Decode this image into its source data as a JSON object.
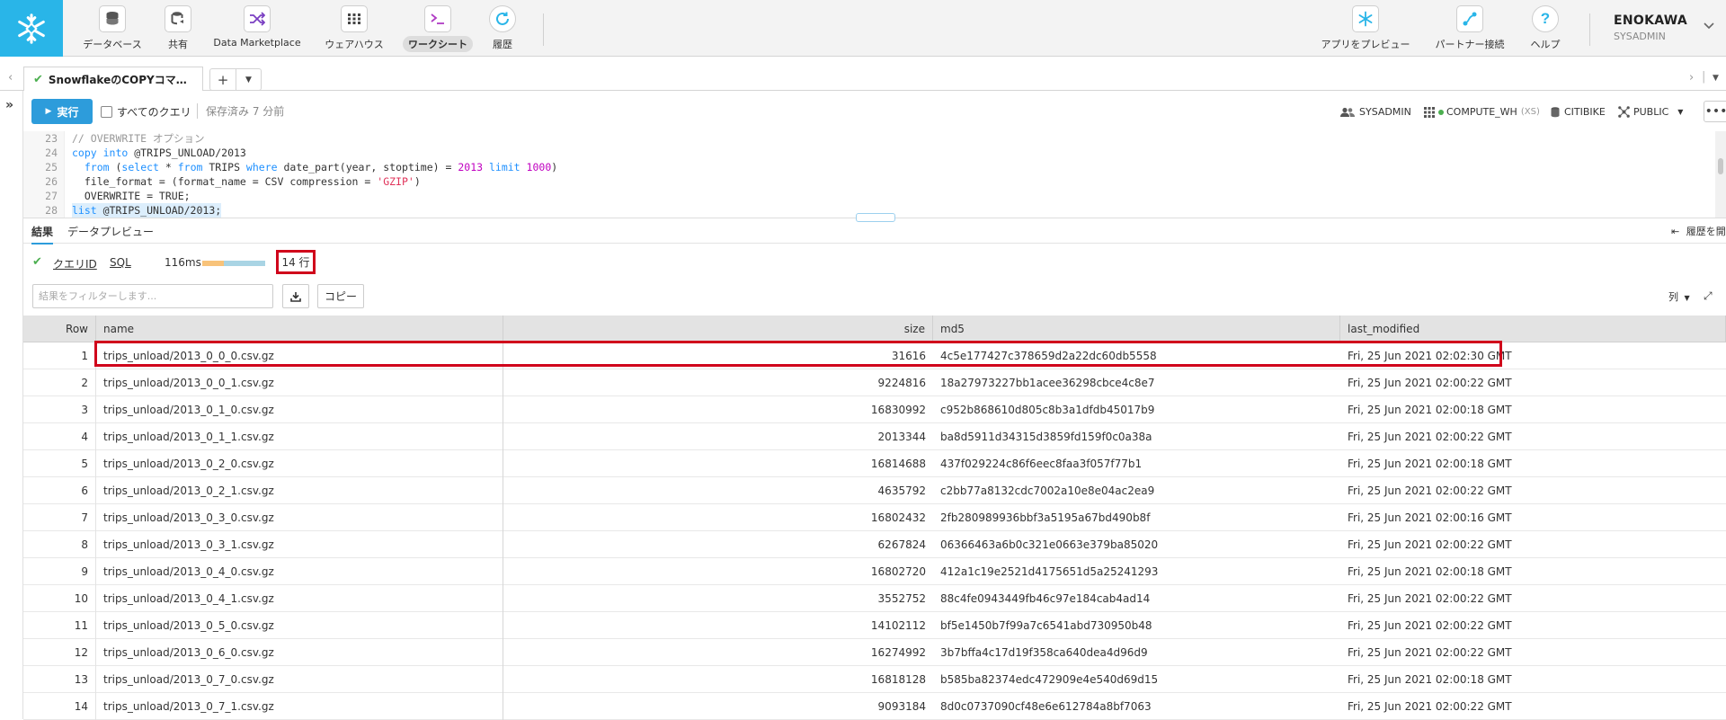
{
  "nav": {
    "items": [
      {
        "label": "データベース",
        "icon": "database-icon"
      },
      {
        "label": "共有",
        "icon": "share-icon"
      },
      {
        "label": "Data Marketplace",
        "icon": "marketplace-icon"
      },
      {
        "label": "ウェアハウス",
        "icon": "warehouse-icon"
      },
      {
        "label": "ワークシート",
        "icon": "worksheet-icon",
        "active": true
      },
      {
        "label": "履歴",
        "icon": "history-icon"
      }
    ],
    "right_items": [
      {
        "label": "アプリをプレビュー",
        "icon": "snowflake-preview-icon"
      },
      {
        "label": "パートナー接続",
        "icon": "partner-connect-icon"
      },
      {
        "label": "ヘルプ",
        "icon": "help-icon"
      }
    ],
    "user": {
      "name": "ENOKAWA",
      "role": "SYSADMIN"
    }
  },
  "tabs": {
    "worksheet_tab": "SnowflakeのCOPYコマ…",
    "add": "+"
  },
  "toolbar": {
    "run_label": "実行",
    "all_queries_label": "すべてのクエリ",
    "saved_label": "保存済み 7 分前",
    "role": "SYSADMIN",
    "warehouse": "COMPUTE_WH",
    "warehouse_size": "(XS)",
    "database": "CITIBIKE",
    "schema": "PUBLIC"
  },
  "editor": {
    "lines": [
      {
        "n": "23",
        "text": "// OVERWRITE オプション"
      },
      {
        "n": "24",
        "text": "copy into @TRIPS_UNLOAD/2013"
      },
      {
        "n": "25",
        "text": "  from (select * from TRIPS where date_part(year, stoptime) = 2013 limit 1000)"
      },
      {
        "n": "26",
        "text": "  file_format = (format_name = CSV compression = 'GZIP')"
      },
      {
        "n": "27",
        "text": "  OVERWRITE = TRUE;"
      },
      {
        "n": "28",
        "text": "list @TRIPS_UNLOAD/2013;"
      }
    ]
  },
  "results": {
    "tab_results": "結果",
    "tab_preview": "データプレビュー",
    "open_history": "履歴を開く",
    "query_id_label": "クエリID",
    "sql_label": "SQL",
    "duration": "116ms",
    "row_count": "14 行",
    "filter_placeholder": "結果をフィルターします...",
    "copy_label": "コピー",
    "columns_label": "列",
    "columns": [
      "Row",
      "name",
      "size",
      "md5",
      "last_modified"
    ],
    "rows": [
      [
        "1",
        "trips_unload/2013_0_0_0.csv.gz",
        "31616",
        "4c5e177427c378659d2a22dc60db5558",
        "Fri, 25 Jun 2021 02:02:30 GMT"
      ],
      [
        "2",
        "trips_unload/2013_0_0_1.csv.gz",
        "9224816",
        "18a27973227bb1acee36298cbce4c8e7",
        "Fri, 25 Jun 2021 02:00:22 GMT"
      ],
      [
        "3",
        "trips_unload/2013_0_1_0.csv.gz",
        "16830992",
        "c952b868610d805c8b3a1dfdb45017b9",
        "Fri, 25 Jun 2021 02:00:18 GMT"
      ],
      [
        "4",
        "trips_unload/2013_0_1_1.csv.gz",
        "2013344",
        "ba8d5911d34315d3859fd159f0c0a38a",
        "Fri, 25 Jun 2021 02:00:22 GMT"
      ],
      [
        "5",
        "trips_unload/2013_0_2_0.csv.gz",
        "16814688",
        "437f029224c86f6eec8faa3f057f77b1",
        "Fri, 25 Jun 2021 02:00:18 GMT"
      ],
      [
        "6",
        "trips_unload/2013_0_2_1.csv.gz",
        "4635792",
        "c2bb77a8132cdc7002a10e8e04ac2ea9",
        "Fri, 25 Jun 2021 02:00:22 GMT"
      ],
      [
        "7",
        "trips_unload/2013_0_3_0.csv.gz",
        "16802432",
        "2fb280989936bbf3a5195a67bd490b8f",
        "Fri, 25 Jun 2021 02:00:16 GMT"
      ],
      [
        "8",
        "trips_unload/2013_0_3_1.csv.gz",
        "6267824",
        "06366463a6b0c321e0663e379ba85020",
        "Fri, 25 Jun 2021 02:00:22 GMT"
      ],
      [
        "9",
        "trips_unload/2013_0_4_0.csv.gz",
        "16802720",
        "412a1c19e2521d4175651d5a25241293",
        "Fri, 25 Jun 2021 02:00:18 GMT"
      ],
      [
        "10",
        "trips_unload/2013_0_4_1.csv.gz",
        "3552752",
        "88c4fe0943449fb46c97e184cab4ad14",
        "Fri, 25 Jun 2021 02:00:22 GMT"
      ],
      [
        "11",
        "trips_unload/2013_0_5_0.csv.gz",
        "14102112",
        "bf5e1450b7f99a7c6541abd730950b48",
        "Fri, 25 Jun 2021 02:00:22 GMT"
      ],
      [
        "12",
        "trips_unload/2013_0_6_0.csv.gz",
        "16274992",
        "3b7bffa4c17d19f358ca640dea4d96d9",
        "Fri, 25 Jun 2021 02:00:22 GMT"
      ],
      [
        "13",
        "trips_unload/2013_0_7_0.csv.gz",
        "16818128",
        "b585ba82374edc472909e4e540d69d15",
        "Fri, 25 Jun 2021 02:00:18 GMT"
      ],
      [
        "14",
        "trips_unload/2013_0_7_1.csv.gz",
        "9093184",
        "8d0c0737090cf48e6e612784a8bf7063",
        "Fri, 25 Jun 2021 02:00:22 GMT"
      ]
    ]
  },
  "colors": {
    "brand": "#29b5e8",
    "run_button": "#2d9cdb",
    "highlight": "#d0021b",
    "success": "#4caf50"
  }
}
